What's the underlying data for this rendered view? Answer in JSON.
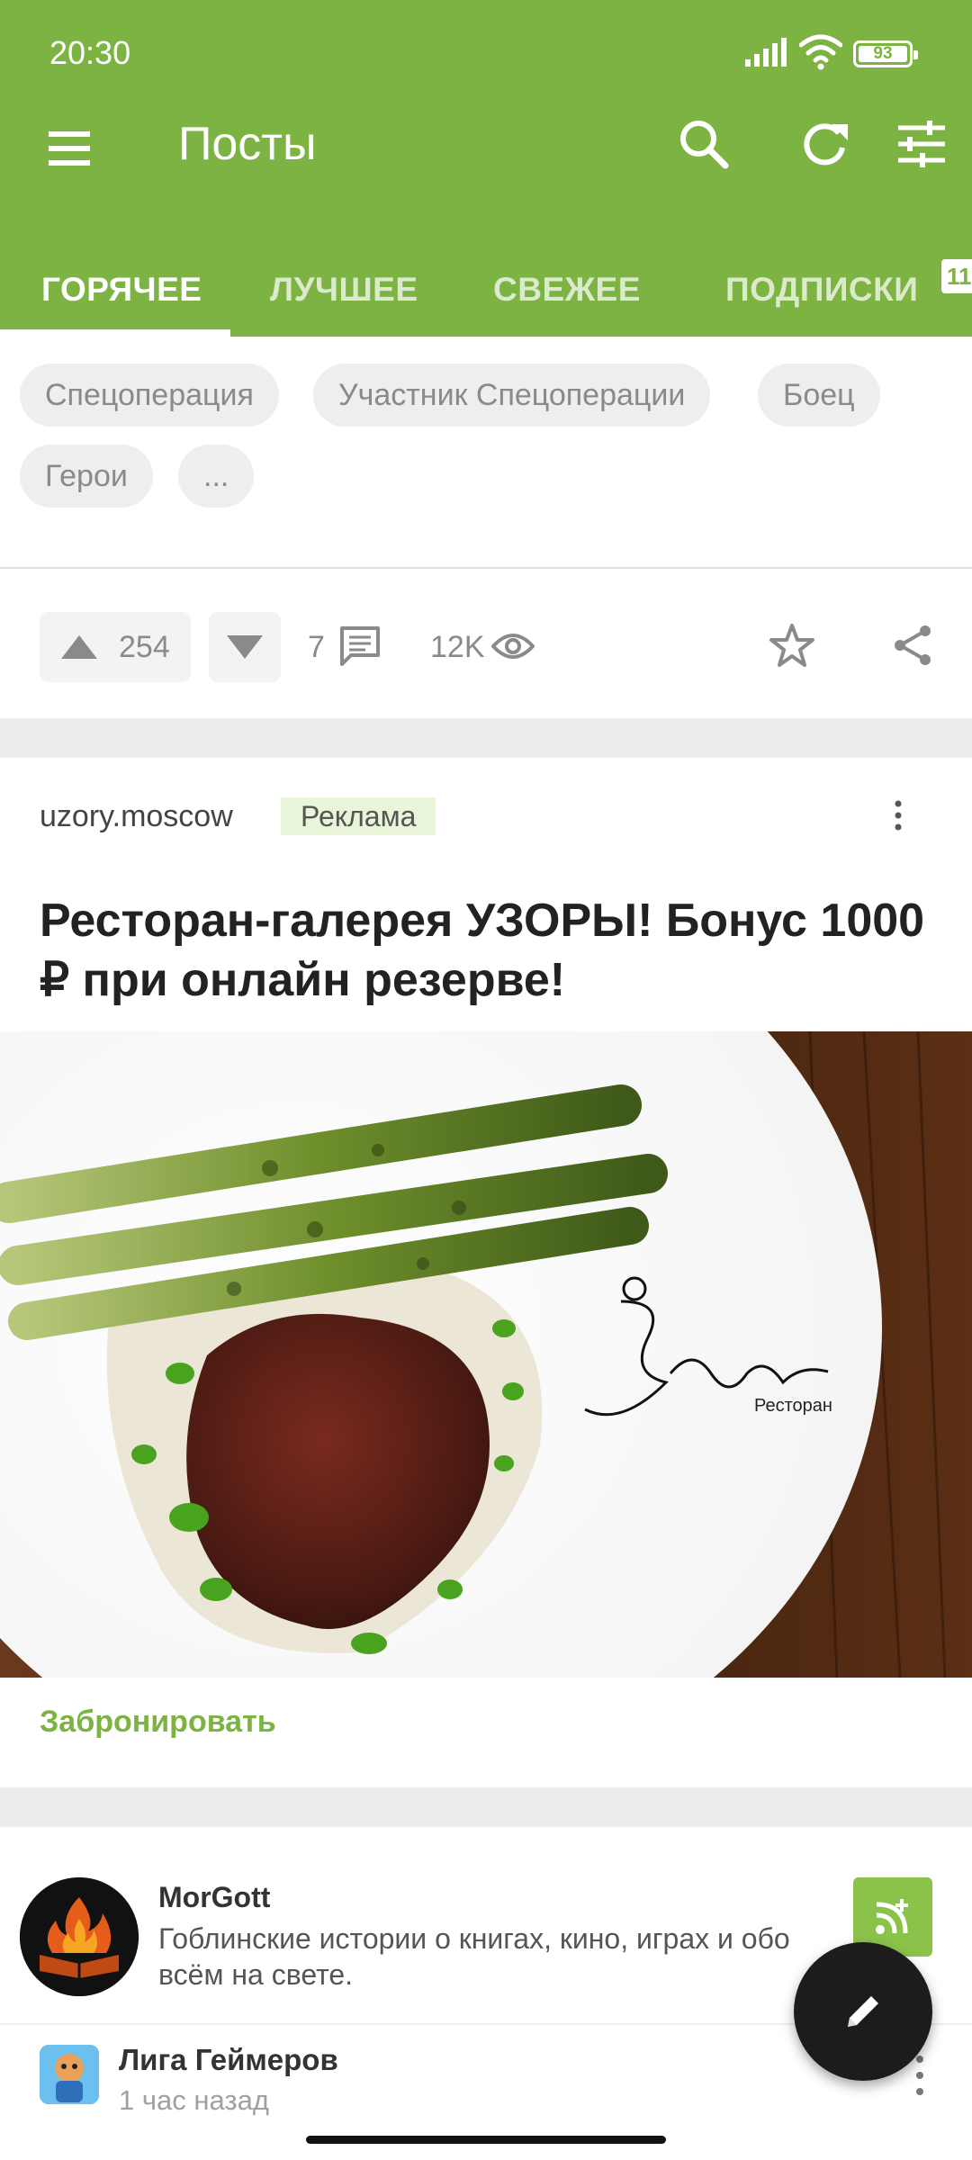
{
  "status_bar": {
    "time": "20:30",
    "battery": "93",
    "icons": [
      "signal-icon",
      "wifi-icon",
      "battery-icon"
    ]
  },
  "toolbar": {
    "title": "Посты",
    "icons": [
      "menu-icon",
      "search-icon",
      "refresh-icon",
      "filter-icon"
    ]
  },
  "tabs": [
    {
      "label": "ГОРЯЧЕЕ",
      "active": true
    },
    {
      "label": "ЛУЧШЕЕ",
      "active": false
    },
    {
      "label": "СВЕЖЕЕ",
      "active": false
    },
    {
      "label": "ПОДПИСКИ",
      "active": false
    }
  ],
  "subscriptions_badge": "11",
  "prev_post": {
    "tags": [
      "Спецоперация",
      "Участник Спецоперации",
      "Боец",
      "Герои",
      "..."
    ],
    "rating": "254",
    "comments": "7",
    "views": "12K"
  },
  "ad": {
    "author": "uzory.moscow",
    "badge": "Реклама",
    "title": "Ресторан-галерея УЗОРЫ! Бонус 1000 ₽ при онлайн резерве!",
    "image_logo_text": "Узоры",
    "image_caption": "Ресторан",
    "cta": "Забронировать"
  },
  "community": {
    "name": "MorGott",
    "description": "Гоблинские истории о книгах, кино, играх и обо всём на свете."
  },
  "next_post": {
    "community": "Лига Геймеров",
    "time": "1 час назад"
  },
  "colors": {
    "primary": "#7cb342",
    "fab": "#1c1c1c",
    "ad_badge_bg": "#e8f5d8"
  }
}
